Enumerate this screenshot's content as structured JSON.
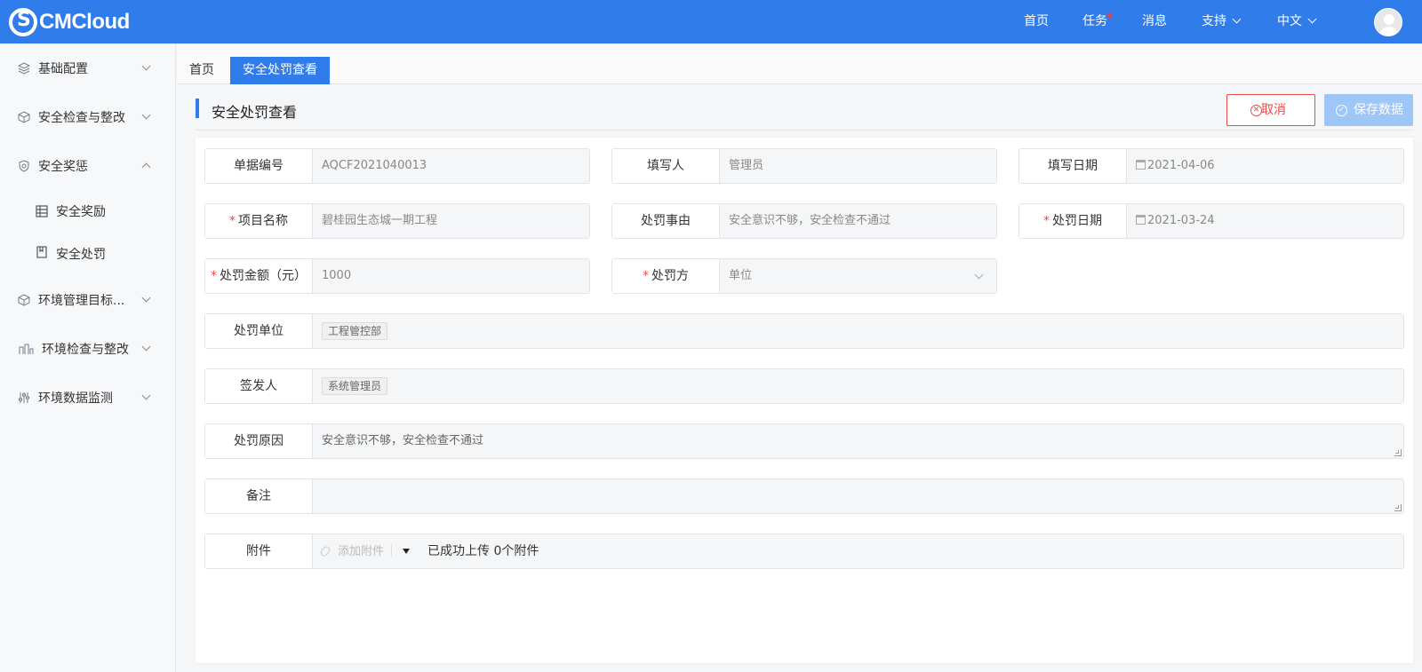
{
  "header": {
    "logo_text": "CMCloud",
    "nav": {
      "home": "首页",
      "tasks": "任务",
      "tasks_badge": "•",
      "messages": "消息",
      "support": "支持",
      "language": "中文"
    }
  },
  "sidebar": {
    "items": [
      {
        "label": "基础配置",
        "icon": "layers-icon"
      },
      {
        "label": "安全检查与整改",
        "icon": "box-check-icon"
      },
      {
        "label": "安全奖惩",
        "icon": "shield-icon"
      },
      {
        "label": "安全奖励",
        "icon": "table-icon"
      },
      {
        "label": "安全处罚",
        "icon": "bookmark-icon"
      },
      {
        "label": "环境管理目标...",
        "icon": "cube-icon"
      },
      {
        "label": "环境检查与整改",
        "icon": "tools-icon"
      },
      {
        "label": "环境数据监测",
        "icon": "sliders-icon"
      }
    ]
  },
  "tabs": [
    {
      "label": "首页",
      "active": false
    },
    {
      "label": "安全处罚查看",
      "active": true
    }
  ],
  "page": {
    "title": "安全处罚查看",
    "cancel_label": "取消",
    "save_label": "保存数据"
  },
  "form": {
    "doc_no": {
      "label": "单据编号",
      "value": "AQCF2021040013"
    },
    "writer": {
      "label": "填写人",
      "value": "管理员"
    },
    "write_date": {
      "label": "填写日期",
      "value": "2021-04-06"
    },
    "project": {
      "label": "项目名称",
      "value": "碧桂园生态城一期工程",
      "required": "*"
    },
    "reason_item": {
      "label": "处罚事由",
      "value": "安全意识不够，安全检查不通过"
    },
    "penalty_date": {
      "label": "处罚日期",
      "value": "2021-03-24",
      "required": "*"
    },
    "amount": {
      "label": "处罚金额（元）",
      "value": "1000",
      "required": "*"
    },
    "party": {
      "label": "处罚方",
      "value": "单位",
      "required": "*"
    },
    "unit": {
      "label": "处罚单位",
      "tag": "工程管控部"
    },
    "issuer": {
      "label": "签发人",
      "tag": "系统管理员"
    },
    "cause": {
      "label": "处罚原因",
      "value": "安全意识不够，安全检查不通过"
    },
    "remark": {
      "label": "备注",
      "value": ""
    },
    "attachment": {
      "label": "附件",
      "add_label": "添加附件",
      "status": "已成功上传 0个附件"
    }
  },
  "colors": {
    "primary": "#2f7cea",
    "danger": "#e94b4b",
    "save_disabled": "#9ec6f6"
  }
}
